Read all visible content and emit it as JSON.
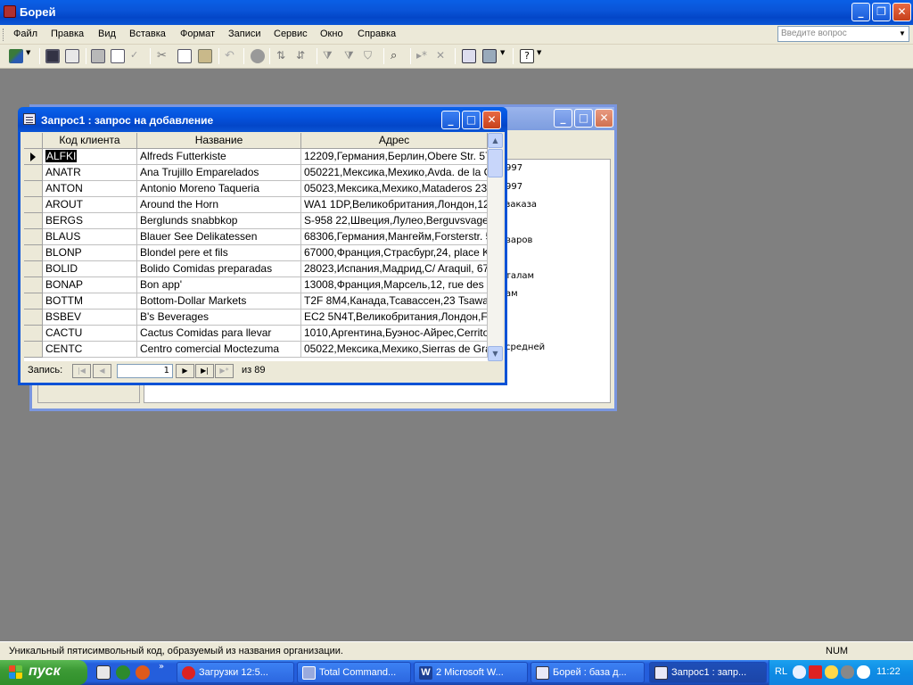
{
  "app": {
    "title": "Борей"
  },
  "menu": [
    "Файл",
    "Правка",
    "Вид",
    "Вставка",
    "Формат",
    "Записи",
    "Сервис",
    "Окно",
    "Справка"
  ],
  "ask": {
    "placeholder": "Введите вопрос"
  },
  "db_window": {
    "obj_items": [
      "997",
      "997",
      "заказа",
      "варов",
      "талам",
      "ам",
      "средней"
    ]
  },
  "query_window": {
    "title": "Запрос1 : запрос на добавление",
    "columns": [
      "Код клиента",
      "Название",
      "Адрес"
    ],
    "rows": [
      [
        "ALFKI",
        "Alfreds Futterkiste",
        "12209,Германия,Берлин,Obere Str. 57"
      ],
      [
        "ANATR",
        "Ana Trujillo Emparelados",
        "050221,Мексика,Мехико,Avda. de la C"
      ],
      [
        "ANTON",
        "Antonio Moreno Taqueria",
        "05023,Мексика,Мехико,Mataderos  23"
      ],
      [
        "AROUT",
        "Around the Horn",
        "WA1 1DP,Великобритания,Лондон,12"
      ],
      [
        "BERGS",
        "Berglunds snabbkop",
        "S-958 22,Швеция,Лулео,Berguvsvager"
      ],
      [
        "BLAUS",
        "Blauer See Delikatessen",
        "68306,Германия,Мангейм,Forsterstr. 5"
      ],
      [
        "BLONP",
        "Blondel pere et fils",
        "67000,Франция,Страсбург,24, place K"
      ],
      [
        "BOLID",
        "Bolido Comidas preparadas",
        "28023,Испания,Мадрид,C/ Araquil, 67"
      ],
      [
        "BONAP",
        "Bon app'",
        "13008,Франция,Марсель,12, rue des I"
      ],
      [
        "BOTTM",
        "Bottom-Dollar Markets",
        "T2F 8M4,Канада,Тсавассен,23 Tsawa"
      ],
      [
        "BSBEV",
        "B's Beverages",
        "EC2 5N4T,Великобритания,Лондон,Fa"
      ],
      [
        "CACTU",
        "Cactus Comidas para llevar",
        "1010,Аргентина,Буэнос-Айрес,Cerrito"
      ],
      [
        "CENTC",
        "Centro comercial Moctezuma",
        "05022,Мексика,Мехико,Sierras de Gra"
      ]
    ],
    "nav": {
      "label": "Запись:",
      "current": "1",
      "of": "из  89"
    }
  },
  "status": {
    "text": "Уникальный пятисимвольный код, образуемый из названия организации.",
    "num": "NUM"
  },
  "taskbar": {
    "start": "пуск",
    "tasks": [
      "Загрузки 12:5...",
      "Total Command...",
      "2 Microsoft W...",
      "Борей : база д...",
      "Запрос1 : запр..."
    ],
    "lang": "RL",
    "clock": "11:22"
  }
}
